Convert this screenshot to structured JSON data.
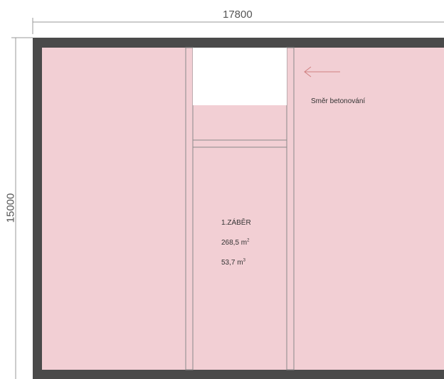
{
  "drawing": {
    "dimension_width": "17800",
    "dimension_height": "15000",
    "direction_label": "Směr betonování",
    "section": {
      "name": "1.ZÁBĚR",
      "area_value": "268,5 m",
      "area_unit_sup": "2",
      "volume_value": "53,7 m",
      "volume_unit_sup": "3"
    }
  },
  "colors": {
    "frame": "#4a4a4a",
    "fill": "#f2cfd4",
    "line": "#8a8a8a",
    "void": "#ffffff"
  }
}
